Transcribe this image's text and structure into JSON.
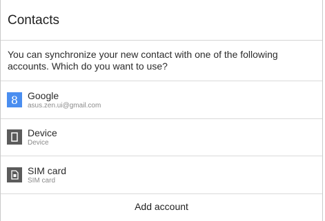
{
  "dialog": {
    "title": "Contacts",
    "message": "You can synchronize your new contact with one of the following accounts. Which do you want to use?",
    "accounts": [
      {
        "name": "Google",
        "detail": "asus.zen.ui@gmail.com",
        "icon": "google-icon"
      },
      {
        "name": "Device",
        "detail": "Device",
        "icon": "device-icon"
      },
      {
        "name": "SIM card",
        "detail": "SIM card",
        "icon": "sim-card-icon"
      }
    ],
    "add_account_label": "Add account"
  },
  "colors": {
    "google_blue": "#4a8ef0",
    "icon_gray": "#5b5b5b",
    "divider": "#d9d9d9"
  }
}
